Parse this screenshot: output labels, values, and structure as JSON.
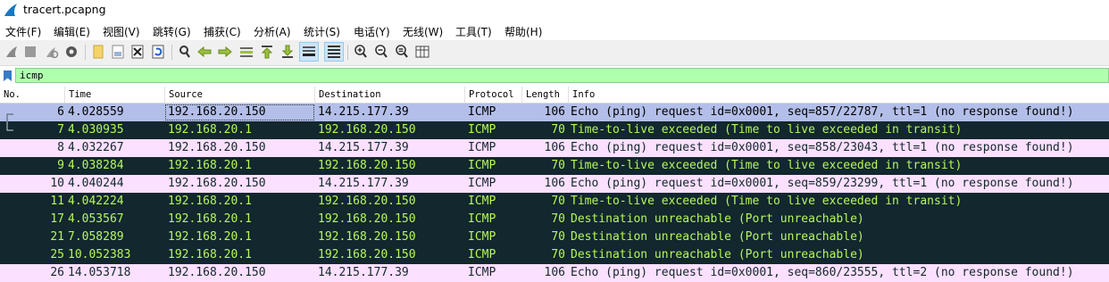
{
  "window": {
    "title": "tracert.pcapng"
  },
  "menu": [
    "文件(F)",
    "编辑(E)",
    "视图(V)",
    "跳转(G)",
    "捕获(C)",
    "分析(A)",
    "统计(S)",
    "电话(Y)",
    "无线(W)",
    "工具(T)",
    "帮助(H)"
  ],
  "toolbar": {
    "icons": [
      "start-capture-icon",
      "stop-capture-icon",
      "restart-capture-icon",
      "capture-options-icon",
      "open-file-icon",
      "save-file-icon",
      "close-file-icon",
      "reload-file-icon",
      "find-packet-icon",
      "go-back-icon",
      "go-forward-icon",
      "go-to-packet-icon",
      "go-first-icon",
      "go-last-icon",
      "auto-scroll-icon",
      "colorize-icon",
      "zoom-in-icon",
      "zoom-out-icon",
      "zoom-normal-icon",
      "resize-columns-icon"
    ]
  },
  "filter": {
    "value": "icmp"
  },
  "columns": [
    "No.",
    "Time",
    "Source",
    "Destination",
    "Protocol",
    "Length",
    "Info"
  ],
  "colors": {
    "selected_bg": "#b3bfe9",
    "echo_bg": "#fce0ff",
    "ttl_bg": "#12272e",
    "ttl_fg": "#f78f78",
    "ttl_fg_alt": "#b5f75a"
  },
  "rows": [
    {
      "no": "6",
      "time": "4.028559",
      "source": "192.168.20.150",
      "destination": "14.215.177.39",
      "protocol": "ICMP",
      "length": "106",
      "info": "Echo (ping) request  id=0x0001, seq=857/22787, ttl=1 (no response found!)",
      "style": "selected"
    },
    {
      "no": "7",
      "time": "4.030935",
      "source": "192.168.20.1",
      "destination": "192.168.20.150",
      "protocol": "ICMP",
      "length": "70",
      "info": "Time-to-live exceeded (Time to live exceeded in transit)",
      "style": "ttl"
    },
    {
      "no": "8",
      "time": "4.032267",
      "source": "192.168.20.150",
      "destination": "14.215.177.39",
      "protocol": "ICMP",
      "length": "106",
      "info": "Echo (ping) request  id=0x0001, seq=858/23043, ttl=1 (no response found!)",
      "style": "echo"
    },
    {
      "no": "9",
      "time": "4.038284",
      "source": "192.168.20.1",
      "destination": "192.168.20.150",
      "protocol": "ICMP",
      "length": "70",
      "info": "Time-to-live exceeded (Time to live exceeded in transit)",
      "style": "ttl"
    },
    {
      "no": "10",
      "time": "4.040244",
      "source": "192.168.20.150",
      "destination": "14.215.177.39",
      "protocol": "ICMP",
      "length": "106",
      "info": "Echo (ping) request  id=0x0001, seq=859/23299, ttl=1 (no response found!)",
      "style": "echo"
    },
    {
      "no": "11",
      "time": "4.042224",
      "source": "192.168.20.1",
      "destination": "192.168.20.150",
      "protocol": "ICMP",
      "length": "70",
      "info": "Time-to-live exceeded (Time to live exceeded in transit)",
      "style": "ttl"
    },
    {
      "no": "17",
      "time": "4.053567",
      "source": "192.168.20.1",
      "destination": "192.168.20.150",
      "protocol": "ICMP",
      "length": "70",
      "info": "Destination unreachable (Port unreachable)",
      "style": "ttl"
    },
    {
      "no": "21",
      "time": "7.058289",
      "source": "192.168.20.1",
      "destination": "192.168.20.150",
      "protocol": "ICMP",
      "length": "70",
      "info": "Destination unreachable (Port unreachable)",
      "style": "ttl"
    },
    {
      "no": "25",
      "time": "10.052383",
      "source": "192.168.20.1",
      "destination": "192.168.20.150",
      "protocol": "ICMP",
      "length": "70",
      "info": "Destination unreachable (Port unreachable)",
      "style": "ttl"
    },
    {
      "no": "26",
      "time": "14.053718",
      "source": "192.168.20.150",
      "destination": "14.215.177.39",
      "protocol": "ICMP",
      "length": "106",
      "info": "Echo (ping) request  id=0x0001, seq=860/23555, ttl=2 (no response found!)",
      "style": "echo"
    }
  ]
}
